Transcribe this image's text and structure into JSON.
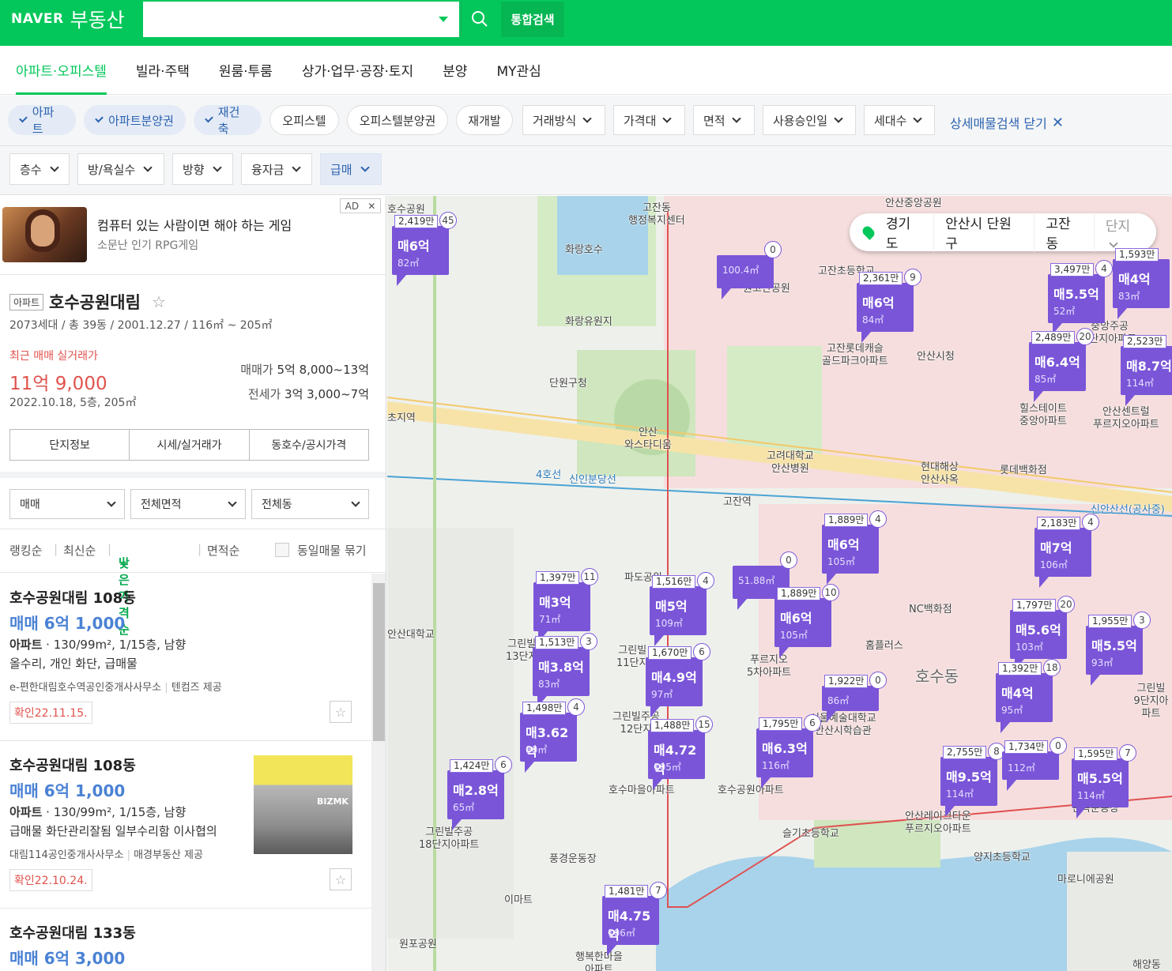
{
  "header": {
    "logo_naver": "NAVER",
    "logo_service": "부동산",
    "search_placeholder": "",
    "total_search": "통합검색"
  },
  "nav": {
    "tabs": [
      {
        "label": "아파트·오피스텔",
        "active": true
      },
      {
        "label": "빌라·주택"
      },
      {
        "label": "원룸·투룸"
      },
      {
        "label": "상가·업무·공장·토지"
      },
      {
        "label": "분양"
      },
      {
        "label": "MY관심"
      }
    ]
  },
  "filters": {
    "chips": [
      "아파트",
      "아파트분양권",
      "재건축",
      "오피스텔",
      "오피스텔분양권",
      "재개발"
    ],
    "dropdowns": [
      "거래방식",
      "가격대",
      "면적",
      "사용승인일",
      "세대수"
    ],
    "close_detail": "상세매물검색 닫기",
    "row2": [
      "층수",
      "방/욕실수",
      "방향",
      "융자금",
      "급매"
    ]
  },
  "ad": {
    "title": "컴퓨터 있는 사람이면 해야 하는 게임",
    "subtitle": "소문난 인기 RPG게임",
    "badge": "AD"
  },
  "complex": {
    "type": "아파트",
    "name": "호수공원대림",
    "info": "2073세대 / 총 39동 / 2001.12.27 / 116㎡ ~ 205㎡",
    "recent_label": "최근 매매 실거래가",
    "recent_price": "11억 9,000",
    "recent_detail": "2022.10.18, 5층, 205㎡",
    "sale_label": "매매가",
    "sale_range": "5억 8,000~13억",
    "jeonse_label": "전세가",
    "jeonse_range": "3억 3,000~7억",
    "tabs": [
      "단지정보",
      "시세/실거래가",
      "동호수/공시가격"
    ]
  },
  "list_filters": {
    "trade": "매매",
    "area": "전체면적",
    "dong": "전체동"
  },
  "sort": {
    "ranking": "랭킹순",
    "latest": "최신순",
    "lowest": "낮은가격순",
    "area": "면적순",
    "same": "동일매물 묶기"
  },
  "listings": [
    {
      "name": "호수공원대림 108동",
      "price": "매매 6억 1,000",
      "spec_type": "아파트",
      "spec": "130/99m², 1/15층, 남향",
      "desc": "올수리, 개인 화단, 급매물",
      "agent": "e-편한대림호수역공인중개사사무소",
      "provider": "텐컴즈 제공",
      "confirm": "확인22.11.15."
    },
    {
      "name": "호수공원대림 108동",
      "price": "매매 6억 1,000",
      "spec_type": "아파트",
      "spec": "130/99m², 1/15층, 남향",
      "desc": "급매물 화단관리잘됨 일부수리함 이사협의",
      "agent": "대림114공인중개사사무소",
      "provider": "매경부동산 제공",
      "confirm": "확인22.10.24.",
      "photo_mark": "BIZMK"
    },
    {
      "name": "호수공원대림 133동",
      "price": "매매 6억 3,000"
    }
  ],
  "map": {
    "location": [
      "경기도",
      "안산시 단원구",
      "고잔동",
      "단지"
    ],
    "place_labels": [
      "호수공원",
      "고잔동\n행정복지센터",
      "안산중앙공원",
      "화랑호수",
      "원고잔공원",
      "고잔초등학교",
      "화랑유원지",
      "고잔롯데캐슬\n골드파크아파트",
      "안산시청",
      "단원구청",
      "안산\n와스타디움",
      "고려대학교\n안산병원",
      "힐스테이트\n중앙아파트",
      "안산센트럴\n푸르지오아파트",
      "현대해상\n안산사옥",
      "롯데백화점",
      "초지역",
      "고잔역",
      "NC백화점",
      "파도공원",
      "그린빌\n13단지",
      "그린빌\n11단지",
      "푸르지오\n5차아파트",
      "홈플러스",
      "호수동",
      "그린빌주공\n12단지",
      "서울예술대학교\n안산시학습관",
      "호수공원아파트",
      "호수마을아파트",
      "그린빌주공\n18단지아파트",
      "풍경운동장",
      "슬기초등학교",
      "안산레이크타운\n푸르지오아파트",
      "양지초등학교",
      "이마트",
      "원포공원",
      "행복한마을\n아파트",
      "마로니에공원",
      "민속운동장",
      "중앙주공\n5단지아파트",
      "4호선",
      "신인분당선",
      "신안산선(공사중)",
      "안산대학교",
      "해양동",
      "그린빌\n9단지아파트"
    ],
    "markers": [
      {
        "pp": "2,419만",
        "pr": "매6억",
        "ar": "82㎡",
        "cnt": "45"
      },
      {
        "pp": "",
        "pr": "",
        "ar": "100.4㎡",
        "cnt": "0"
      },
      {
        "pp": "2,361만",
        "pr": "매6억",
        "ar": "84㎡",
        "cnt": "9"
      },
      {
        "pp": "3,497만",
        "pr": "매5.5억",
        "ar": "52㎡",
        "cnt": "4"
      },
      {
        "pp": "1,593만",
        "pr": "매4억",
        "ar": "83㎡",
        "cnt": ""
      },
      {
        "pp": "2,489만",
        "pr": "매6.4억",
        "ar": "85㎡",
        "cnt": "20"
      },
      {
        "pp": "2,523만",
        "pr": "매8.7억",
        "ar": "114㎡",
        "cnt": ""
      },
      {
        "pp": "1,889만",
        "pr": "매6억",
        "ar": "105㎡",
        "cnt": "4"
      },
      {
        "pp": "2,183만",
        "pr": "매7억",
        "ar": "106㎡",
        "cnt": "4"
      },
      {
        "pp": "",
        "pr": "",
        "ar": "51.88㎡",
        "cnt": "0"
      },
      {
        "pp": "1,397만",
        "pr": "매3억",
        "ar": "71㎡",
        "cnt": "11"
      },
      {
        "pp": "1,516만",
        "pr": "매5억",
        "ar": "109㎡",
        "cnt": "4"
      },
      {
        "pp": "1,889만",
        "pr": "매6억",
        "ar": "105㎡",
        "cnt": "10"
      },
      {
        "pp": "1,797만",
        "pr": "매5.6억",
        "ar": "103㎡",
        "cnt": "20"
      },
      {
        "pp": "1,955만",
        "pr": "매5.5억",
        "ar": "93㎡",
        "cnt": "3"
      },
      {
        "pp": "1,513만",
        "pr": "매3.8억",
        "ar": "83㎡",
        "cnt": "3"
      },
      {
        "pp": "1,670만",
        "pr": "매4.9억",
        "ar": "97㎡",
        "cnt": "6"
      },
      {
        "pp": "1,922만",
        "pr": "",
        "ar": "86㎡",
        "cnt": "0"
      },
      {
        "pp": "1,392만",
        "pr": "매4억",
        "ar": "95㎡",
        "cnt": "18"
      },
      {
        "pp": "1,498만",
        "pr": "매3.62억",
        "ar": "80㎡",
        "cnt": "4"
      },
      {
        "pp": "1,488만",
        "pr": "매4.72억",
        "ar": "105㎡",
        "cnt": "15"
      },
      {
        "pp": "1,795만",
        "pr": "매6.3억",
        "ar": "116㎡",
        "cnt": "6"
      },
      {
        "pp": "1,424만",
        "pr": "매2.8억",
        "ar": "65㎡",
        "cnt": "6"
      },
      {
        "pp": "2,755만",
        "pr": "매9.5억",
        "ar": "114㎡",
        "cnt": "8"
      },
      {
        "pp": "1,734만",
        "pr": "",
        "ar": "112㎡",
        "cnt": "0"
      },
      {
        "pp": "1,595만",
        "pr": "매5.5억",
        "ar": "114㎡",
        "cnt": "7"
      },
      {
        "pp": "1,481만",
        "pr": "매4.75억",
        "ar": "106㎡",
        "cnt": "7"
      }
    ]
  }
}
